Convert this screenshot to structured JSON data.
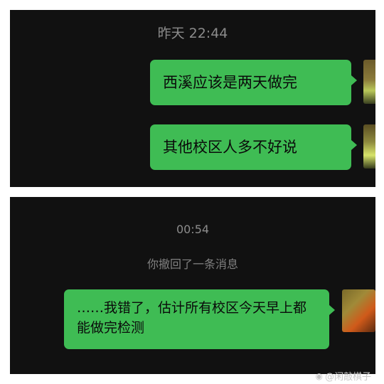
{
  "top_panel": {
    "timestamp": "昨天 22:44",
    "messages": [
      {
        "text": "西溪应该是两天做完"
      },
      {
        "text": "其他校区人多不好说"
      }
    ]
  },
  "bottom_panel": {
    "timestamp": "00:54",
    "system_note": "你撤回了一条消息",
    "messages": [
      {
        "text": "……我错了，估计所有校区今天早上都能做完检测"
      }
    ]
  },
  "watermark": {
    "icon": "weibo-icon",
    "text": "@闲敲棋子"
  },
  "colors": {
    "bubble": "#3fbc54",
    "panel_bg": "#111111"
  }
}
